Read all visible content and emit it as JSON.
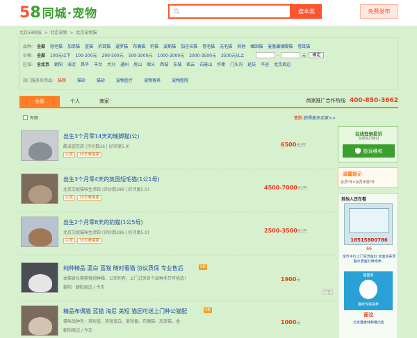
{
  "header": {
    "logo_num": "58",
    "logo_text": "同城·宠物",
    "search_placeholder": "",
    "search_button": "搜本类",
    "post_button": "免费发布"
  },
  "breadcrumb": [
    "北京58同城",
    ">",
    "北京宠物",
    ">",
    "北京宠物猫"
  ],
  "filters": {
    "breed": {
      "label": "品种:",
      "items": [
        "全部",
        "短毛猫",
        "加菲猫",
        "蓝猫",
        "折耳猫",
        "暹罗猫",
        "布偶猫",
        "豹猫",
        "波斯猫",
        "加吉拉猫",
        "卷毛猫",
        "无毛猫",
        "其他",
        "缅因猫",
        "曼基康矮脚猫",
        "卷耳猫"
      ]
    },
    "price": {
      "label": "价格:",
      "items": [
        "全部",
        "100元以下",
        "100-200元",
        "200-500元",
        "500-1000元",
        "1000-2000元",
        "2000-3500元",
        "3500元以上"
      ],
      "sep": "-",
      "unit": "元",
      "ok": "确定"
    },
    "area": {
      "label": "区域:",
      "items": [
        "全北京",
        "朝阳",
        "海淀",
        "昌平",
        "丰台",
        "大兴",
        "通州",
        "房山",
        "顺义",
        "西城",
        "东城",
        "密云",
        "石景山",
        "怀柔",
        "门头沟",
        "延庆",
        "平谷",
        "北京周边"
      ]
    },
    "hot": {
      "label": "热门服务及用品:",
      "items": [
        "猫粮",
        "猫砂",
        "猫砂",
        "宠物医疗",
        "宠物寄养",
        "宠物医院"
      ]
    }
  },
  "tabs": {
    "all": "全部",
    "personal": "个人",
    "merchant": "商家"
  },
  "hotline": {
    "label": "商家推广合作热线:",
    "number": "400-850-3662"
  },
  "options": {
    "has_image": "有图",
    "right_red": "曹鹏:",
    "right_text": "获得更多买家>>"
  },
  "listings": [
    {
      "title": "出生3个月零14天的矮脚猫(公)",
      "desc": "酷派望京店  (评价数26 | 好评度5.0)",
      "tags": [
        "心宠",
        "30天看健康"
      ],
      "price": "6500",
      "unit": "元/只"
    },
    {
      "title": "出生3个月零4天的英国短毛猫(1公1母)",
      "desc": "北京艾妮猫咪生活馆  (评价数286 | 好评度5.0)",
      "tags": [
        "心宠",
        "30天看健康"
      ],
      "price": "4500-7000",
      "unit": "元/只"
    },
    {
      "title": "出生2个月零8天的豹猫(1公5母)",
      "desc": "北京艾妮猫咪生活馆  (评价数286 | 好评度5.0)",
      "tags": [
        "心宠",
        "30天看健康"
      ],
      "price": "2500-3500",
      "unit": "元/只"
    },
    {
      "title": "纯种精品 蓝白 蓝猫 随时看猫 协议质保 专业售后",
      "desc": "本猫舍长期繁殖纯种猫，公司均有，上门过来各个品种多只可挑选！",
      "sub": "朝阳  ·  朝阳周边 / 今天",
      "price": "1900",
      "unit": "元",
      "ad": "广告",
      "badge": "5年"
    },
    {
      "title": "精品布偶猫 蓝猫 海尼 美短 猫因可送上门种公猫配",
      "desc": "猫咪品种有：英短蓝、英短蓝白、美短银、布偶猫、加菲猫、金",
      "sub": "朝阳周边 / 今天",
      "price": "1000",
      "unit": "元",
      "badge": "5年"
    }
  ],
  "sidebar": {
    "guard_title": "在线登录投诉",
    "guard_sub": "享受先行赔付",
    "guard_btn": "投诉维权",
    "tips_title": "温馨提示",
    "tips_text": "会员*年=会员年限*年",
    "others_title": "其他人还在看",
    "ad1_phone": "18515800786",
    "ad1_num": "66",
    "ad1_caption": "全市平价上门清洗鱼缸 全面消毒调整水质鱼缸维修养...",
    "ad2_top": "猫猫家",
    "ad2_bottom": "猫咪专属寄养",
    "ad2_caption": "面议",
    "ad2_caption2": "北京猫舍纯种猫出售"
  },
  "colors": {
    "accent": "#ff552e",
    "green": "#3aa02d",
    "tab_orange": "#ff7f27",
    "bg": "#d7f0cd",
    "link": "#1f4da3",
    "price": "#e8391c"
  }
}
